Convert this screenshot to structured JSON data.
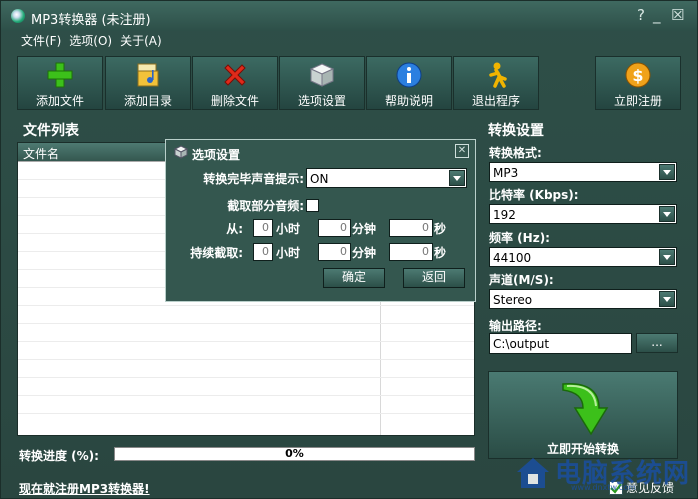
{
  "window": {
    "title": "MP3转换器 (未注册)",
    "controls": [
      "?",
      "_",
      "☒"
    ]
  },
  "menu": [
    "文件(F)",
    "选项(O)",
    "关于(A)"
  ],
  "toolbar": {
    "buttons": [
      {
        "label": "添加文件",
        "icon": "add-plus-icon"
      },
      {
        "label": "添加目录",
        "icon": "folder-note-icon"
      },
      {
        "label": "删除文件",
        "icon": "delete-x-icon"
      },
      {
        "label": "选项设置",
        "icon": "cube-options-icon"
      },
      {
        "label": "帮助说明",
        "icon": "info-icon"
      },
      {
        "label": "退出程序",
        "icon": "running-man-icon"
      },
      {
        "label": "立即注册",
        "icon": "dollar-coin-icon"
      }
    ]
  },
  "file_list": {
    "section_title": "文件列表",
    "column_header": "文件名"
  },
  "progress": {
    "label": "转换进度 (%):",
    "value": 0,
    "text": "0%"
  },
  "footer": {
    "register_link": "现在就注册MP3转换器!",
    "feedback": "意见反馈"
  },
  "settings": {
    "section_title": "转换设置",
    "format_label": "转换格式:",
    "format_value": "MP3",
    "bitrate_label": "比特率 (Kbps):",
    "bitrate_value": "192",
    "samplerate_label": "频率 (Hz):",
    "samplerate_value": "44100",
    "channel_label": "声道(M/S):",
    "channel_value": "Stereo",
    "output_label": "输出路径:",
    "output_value": "C:\\output",
    "browse_label": "...",
    "convert_label": "立即开始转换"
  },
  "dialog": {
    "title": "选项设置",
    "sound_label": "转换完毕声音提示:",
    "sound_value": "ON",
    "clip_label": "截取部分音频:",
    "from_label": "从:",
    "duration_label": "持续截取:",
    "hour_unit": "小时",
    "minute_unit": "分钟",
    "second_unit": "秒",
    "from_hours": "0",
    "from_minutes": "0",
    "from_seconds": "0",
    "dur_hours": "0",
    "dur_minutes": "0",
    "dur_seconds": "0",
    "ok_label": "确定",
    "back_label": "返回"
  },
  "watermark": {
    "text": "电脑系统网",
    "sub": "www.dnxtw.com"
  },
  "colors": {
    "window_bg": "#2f4e47",
    "accent_green": "#3cc01a",
    "watermark_blue": "#1a4fa0"
  }
}
